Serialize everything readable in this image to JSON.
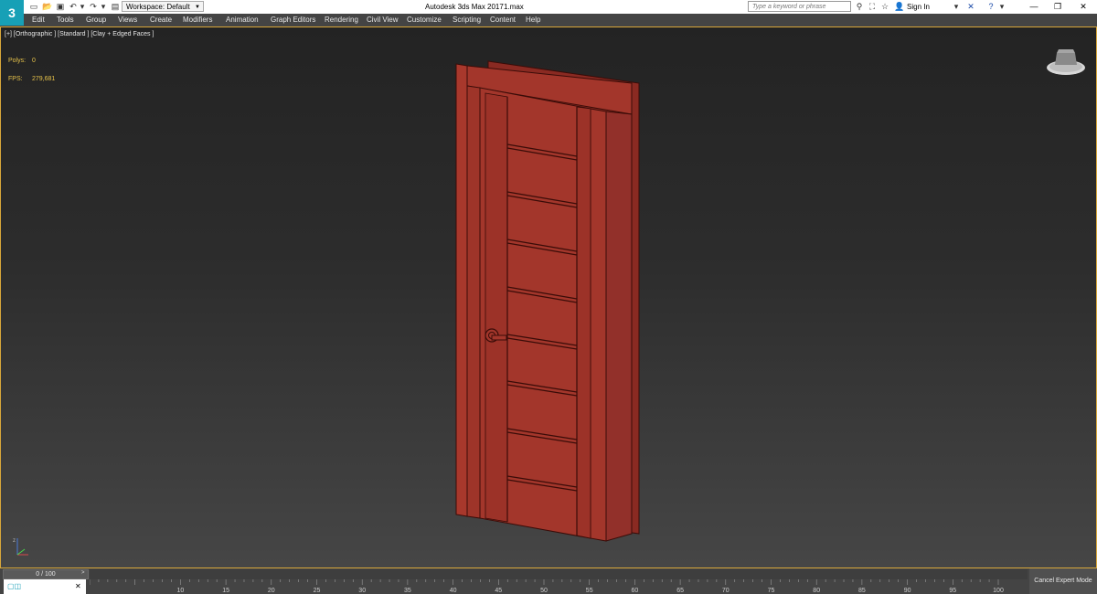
{
  "titlebar": {
    "logo": "3",
    "workspace_label": "Workspace: Default",
    "app_title": "Autodesk 3ds Max 2017",
    "file_name": "1.max",
    "search_placeholder": "Type a keyword or phrase",
    "signin_label": "Sign In"
  },
  "menu": {
    "items": [
      "Edit",
      "Tools",
      "Group",
      "Views",
      "Create",
      "Modifiers",
      "Animation",
      "Graph Editors",
      "Rendering",
      "Civil View",
      "Customize",
      "Scripting",
      "Content",
      "Help"
    ]
  },
  "viewport": {
    "label": "[+] [Orthographic ] [Standard ] [Clay + Edged Faces ]",
    "polys_label": "Polys:",
    "polys_value": "0",
    "fps_label": "FPS:",
    "fps_value": "279,681",
    "model_color": "#a3362b"
  },
  "timeline": {
    "slider_text": "0 / 100",
    "ticks": [
      "10",
      "15",
      "20",
      "25",
      "30",
      "35",
      "40",
      "45",
      "50",
      "55",
      "60",
      "65",
      "70",
      "75",
      "80",
      "85",
      "90",
      "95",
      "100"
    ]
  },
  "statusbar": {
    "cancel_expert_label": "Cancel Expert Mode"
  },
  "colors": {
    "viewport_border": "#d8a73a",
    "stats_text": "#e6c24a",
    "menu_bg": "#444444",
    "logo_bg": "#17a0b6"
  }
}
